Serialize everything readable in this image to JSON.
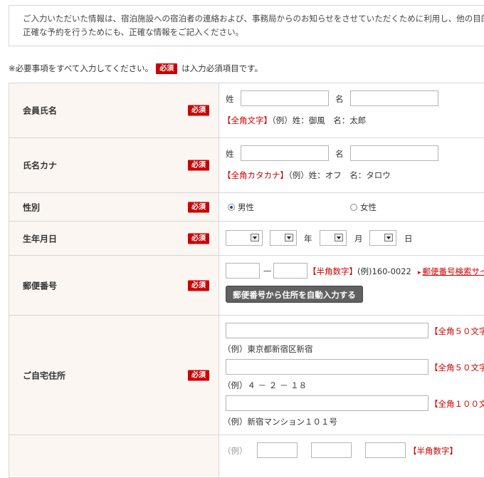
{
  "notice": {
    "line1": "ご入力いただいた情報は、宿泊施設への宿泊者の連絡および、事務局からのお知らせをさせていただくために利用し、他の目的",
    "line2": "正確な予約を行うためにも、正確な情報をご記入ください。"
  },
  "required_note": {
    "prefix": "※必要事項をすべて入力してください。",
    "badge": "必須",
    "suffix": "は入力必須項目です。"
  },
  "badge_label": "必須",
  "rows": {
    "name": {
      "label": "会員氏名",
      "sei": "姓",
      "mei": "名",
      "note_red": "【全角文字】",
      "note": "（例）姓：御風　名：太郎"
    },
    "kana": {
      "label": "氏名カナ",
      "sei": "姓",
      "mei": "名",
      "note_red": "【全角カタカナ】",
      "note": "（例）姓：オフ　名：タロウ"
    },
    "gender": {
      "label": "性別",
      "male": "男性",
      "female": "女性",
      "selected": "male"
    },
    "birth": {
      "label": "生年月日",
      "year": "年",
      "month": "月",
      "day": "日"
    },
    "postal": {
      "label": "郵便番号",
      "dash": "—",
      "note_red": "【半角数字】",
      "note": "(例)160-0022",
      "link": "郵便番号検索サイ",
      "button": "郵便番号から住所を自動入力する"
    },
    "address": {
      "label": "ご自宅住所",
      "limit1": "【全角５０文字",
      "ex1": "（例）東京都新宿区新宿",
      "limit2": "【全角５０文字",
      "ex2": "（例）４ － ２ － １８",
      "limit3": "【全角１００文",
      "ex3": "（例）新宿マンション１０１号"
    },
    "phone": {
      "ex": "（例）",
      "link": "【半角数字】"
    }
  }
}
